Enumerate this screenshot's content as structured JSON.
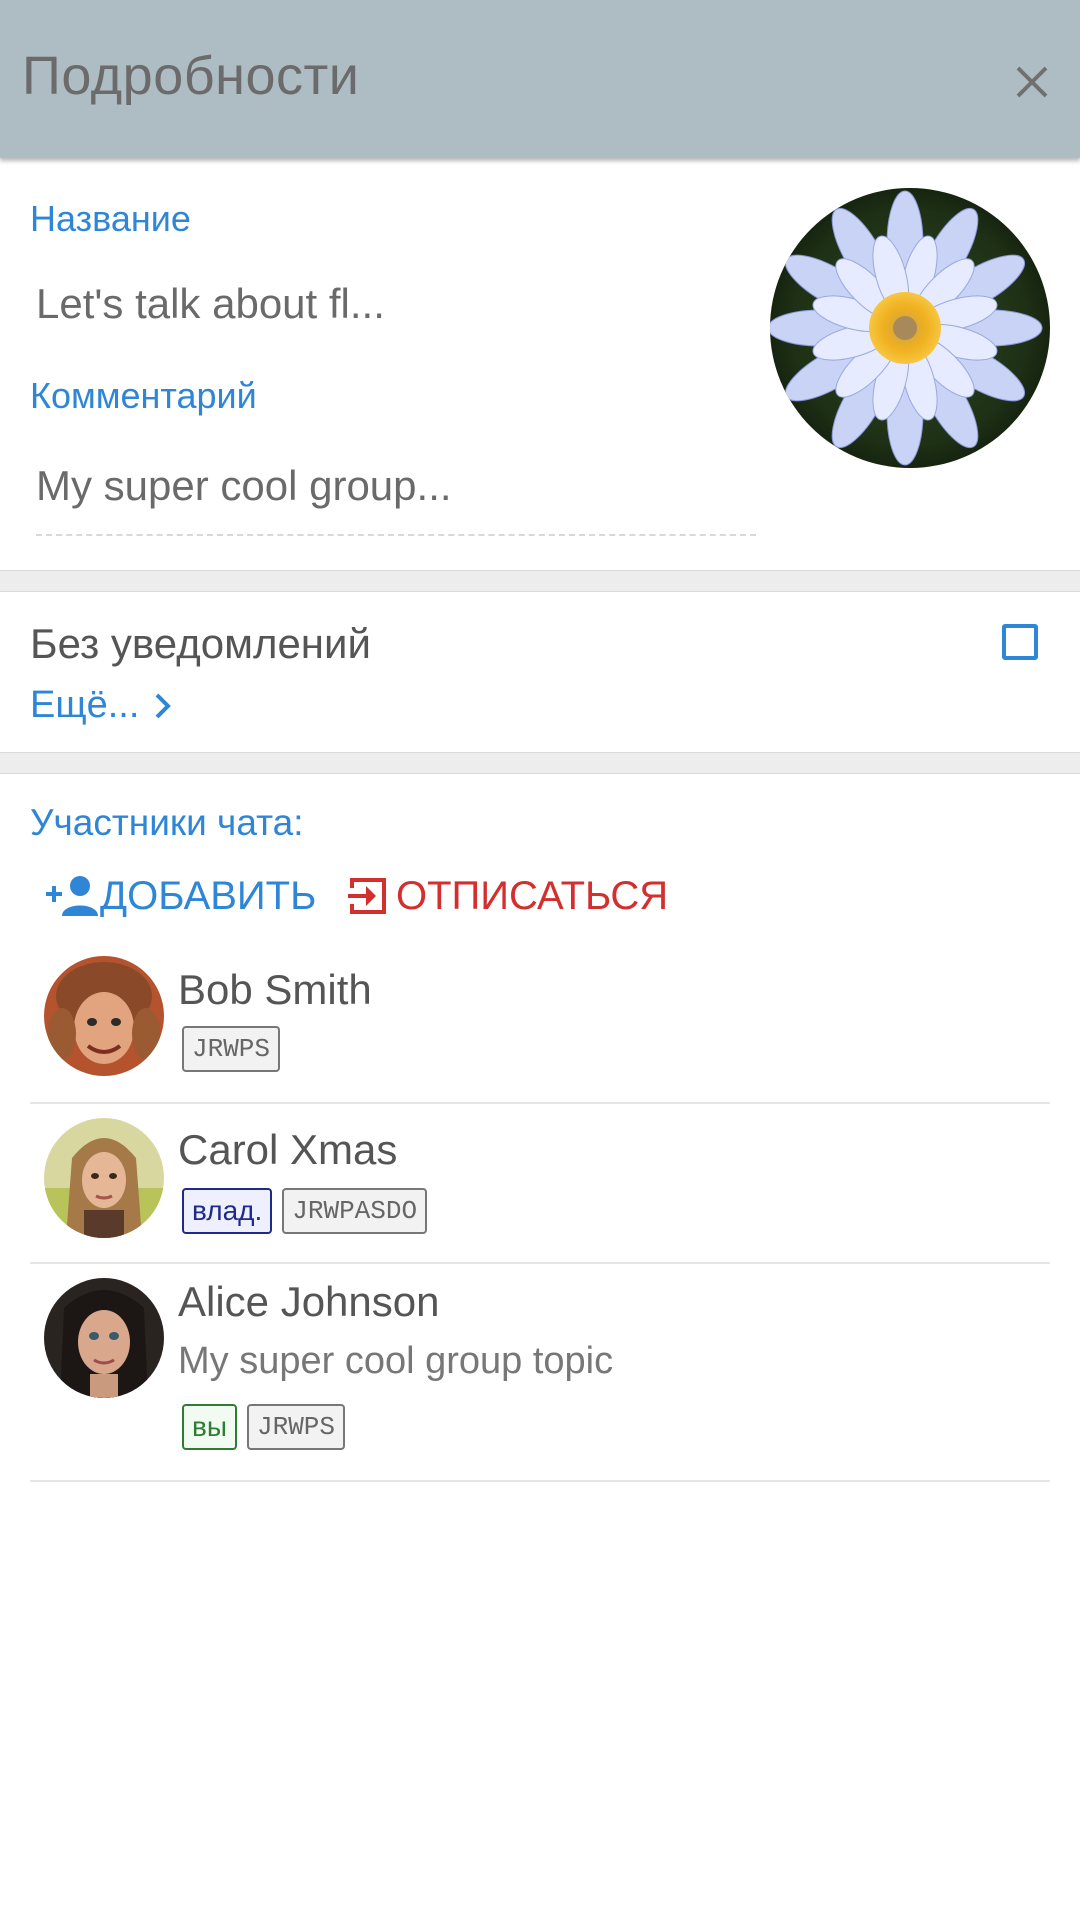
{
  "header": {
    "title": "Подробности",
    "close_icon": "close-icon"
  },
  "topic": {
    "name_label": "Название",
    "name_value": "Let's talk about fl...",
    "comment_label": "Комментарий",
    "comment_value": "My super cool group...",
    "avatar_icon": "flower-avatar"
  },
  "settings": {
    "muted_label": "Без уведомлений",
    "muted_checked": false,
    "more_label": "Ещё..."
  },
  "members": {
    "section_label": "Участники чата:",
    "add_label": "ДОБАВИТЬ",
    "leave_label": "ОТПИСАТЬСЯ",
    "list": [
      {
        "name": "Bob Smith",
        "status": "",
        "badges": [
          {
            "text": "JRWPS",
            "kind": "perm"
          }
        ]
      },
      {
        "name": "Carol Xmas",
        "status": "",
        "badges": [
          {
            "text": "влад.",
            "kind": "owner"
          },
          {
            "text": "JRWPASDO",
            "kind": "perm"
          }
        ]
      },
      {
        "name": "Alice Johnson",
        "status": "My super cool group topic",
        "badges": [
          {
            "text": "вы",
            "kind": "you"
          },
          {
            "text": "JRWPS",
            "kind": "perm"
          }
        ]
      }
    ]
  },
  "colors": {
    "header_bg": "#aebcc4",
    "accent_blue": "#2f86d6",
    "danger_red": "#d32f2f"
  }
}
